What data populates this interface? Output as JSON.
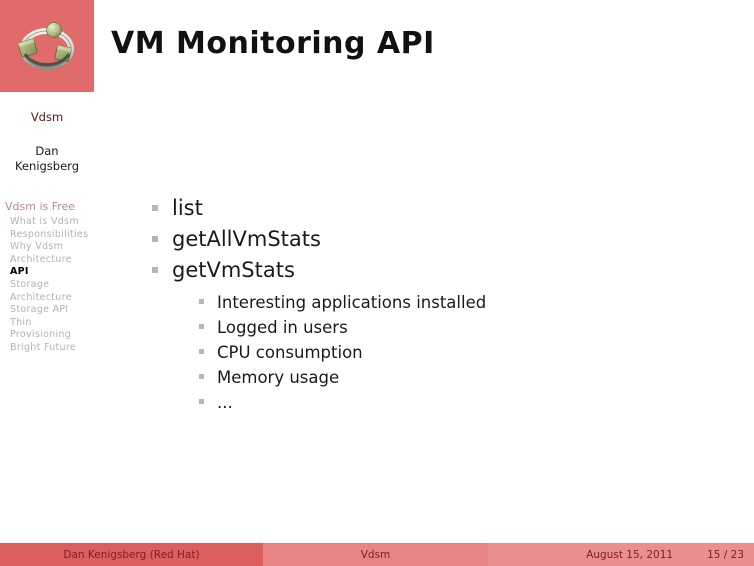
{
  "header": {
    "title": "VM Monitoring API",
    "logo_icon": "vdsm-ring-logo"
  },
  "sidebar": {
    "short_title": "Vdsm",
    "author_line1": "Dan",
    "author_line2": "Kenigsberg",
    "toc": [
      {
        "label": "Vdsm is Free",
        "type": "section",
        "active": false
      },
      {
        "label": "What is Vdsm",
        "type": "item",
        "active": false
      },
      {
        "label": "Responsibilities",
        "type": "item",
        "active": false
      },
      {
        "label": "Why Vdsm",
        "type": "item",
        "active": false
      },
      {
        "label": "Architecture",
        "type": "item",
        "active": false
      },
      {
        "label": "API",
        "type": "item",
        "active": true
      },
      {
        "label": "Storage Architecture",
        "type": "item",
        "active": false
      },
      {
        "label": "Storage API",
        "type": "item",
        "active": false
      },
      {
        "label": "Thin Provisioning",
        "type": "item",
        "active": false
      },
      {
        "label": "Bright Future",
        "type": "item",
        "active": false
      }
    ]
  },
  "content": {
    "bullets": [
      {
        "text": "list"
      },
      {
        "text": "getAllVmStats"
      },
      {
        "text": "getVmStats",
        "children": [
          {
            "text": "Interesting applications installed"
          },
          {
            "text": "Logged in users"
          },
          {
            "text": "CPU consumption"
          },
          {
            "text": "Memory usage"
          },
          {
            "text": "..."
          }
        ]
      }
    ]
  },
  "footer": {
    "left": "Dan Kenigsberg  (Red Hat)",
    "middle": "Vdsm",
    "date": "August 15, 2011",
    "page": "15 / 23"
  },
  "colors": {
    "accent_red": "#e16a6a",
    "footer_left": "#dd5e5e",
    "footer_mid": "#e88484",
    "footer_right": "#ea8f8f",
    "footer_text": "#7d1f1f",
    "toc_inactive": "#b3b3b3",
    "toc_section": "#b98a8a",
    "bullet_gray": "#b5b5b5"
  }
}
